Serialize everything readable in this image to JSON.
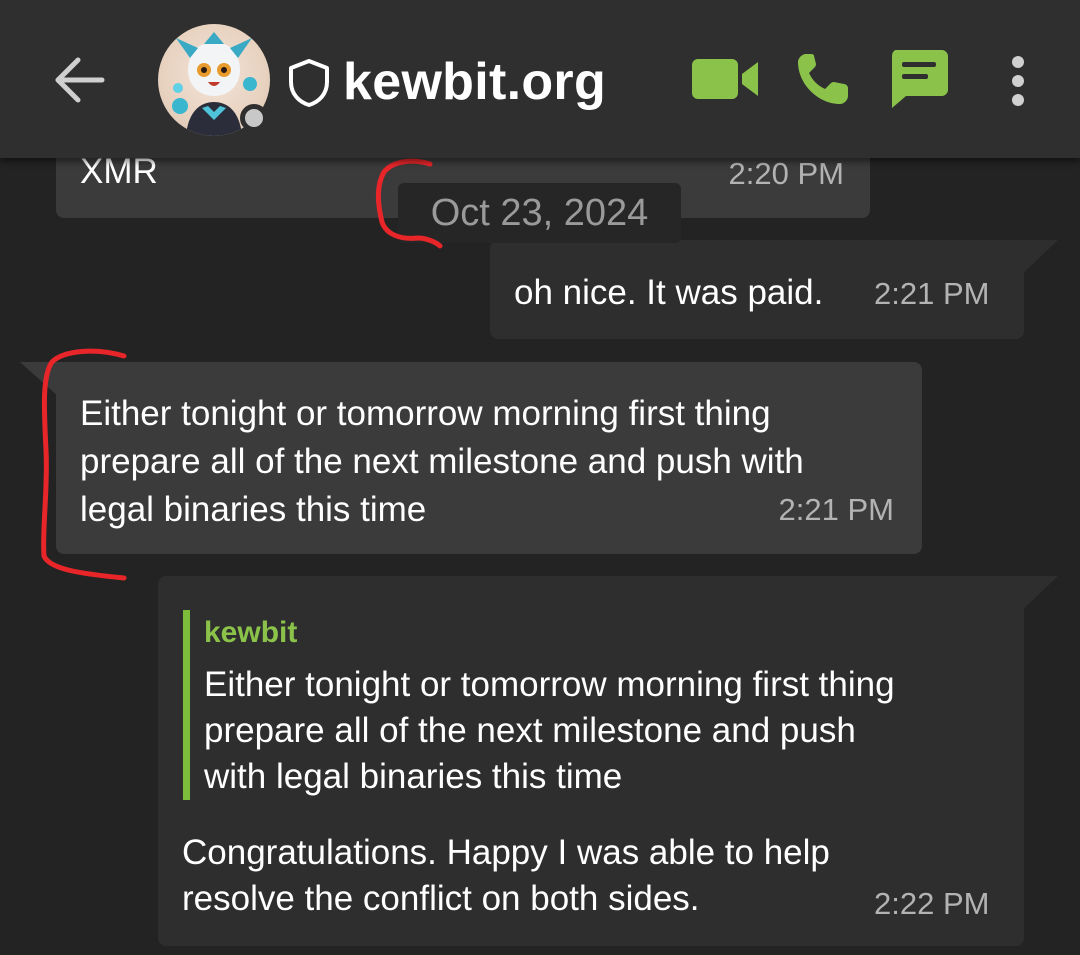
{
  "header": {
    "contact_name": "kewbit.org",
    "presence": "offline"
  },
  "messages": [
    {
      "direction": "in",
      "text": "XMR",
      "time": "2:20 PM"
    },
    {
      "direction": "out",
      "text": "oh nice. It was paid.",
      "time": "2:21 PM"
    },
    {
      "direction": "in",
      "text": "Either tonight or tomorrow morning first thing\nprepare all of the next milestone and push with\nlegal binaries this time",
      "time": "2:21 PM"
    },
    {
      "direction": "out",
      "reply": {
        "author": "kewbit",
        "text": "Either tonight or tomorrow morning first thing\nprepare all of the next milestone and push\nwith legal binaries this time"
      },
      "text": "Congratulations. Happy I was able to help\nresolve the conflict on both sides.",
      "time": "2:22 PM"
    }
  ],
  "date_separator": "Oct 23, 2024",
  "colors": {
    "accent_green": "#8bc34a",
    "annotation_red": "#e8262a",
    "background": "#232323",
    "header": "#2f2f2f"
  },
  "icons": [
    "back-arrow-icon",
    "shield-icon",
    "video-call-icon",
    "phone-icon",
    "message-icon",
    "more-vert-icon"
  ]
}
